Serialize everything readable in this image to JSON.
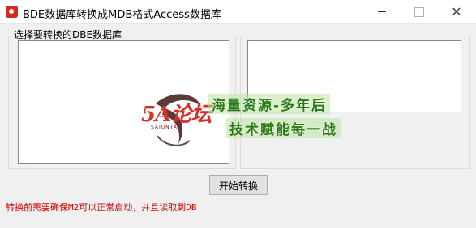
{
  "window": {
    "title": "BDE数据库转换成MDB格式Access数据库",
    "minimize_glyph": "—",
    "close_glyph": "✕"
  },
  "group": {
    "legend": "选择要转换的DBE数据库"
  },
  "buttons": {
    "start_label": "开始转换"
  },
  "note": {
    "text": "转换前需要确保M2可以正常启动，并且读取到DB",
    "color": "#cc0000"
  },
  "watermark": {
    "logo_text": "5A论坛",
    "logo_sub": "SAIUNTAN",
    "line1": "海量资源-多年后",
    "line2": "技术赋能每一战"
  }
}
